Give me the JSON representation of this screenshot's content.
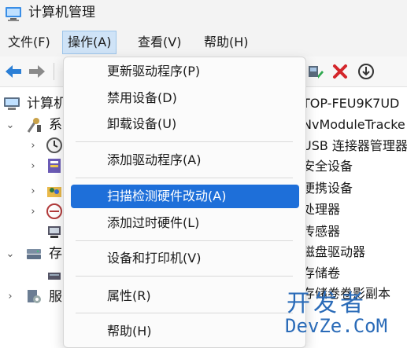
{
  "window": {
    "title": "计算机管理"
  },
  "menubar": {
    "items": [
      {
        "label": "文件(F)"
      },
      {
        "label": "操作(A)",
        "active": true
      },
      {
        "label": "查看(V)"
      },
      {
        "label": "帮助(H)"
      }
    ]
  },
  "toolbar": {
    "buttons": [
      "back-arrow-icon",
      "forward-arrow-icon",
      "update-driver-icon",
      "remove-icon",
      "download-icon"
    ]
  },
  "tree": {
    "root": "计算机",
    "system_partial": "系",
    "storage_partial": "存",
    "services_partial": "服"
  },
  "right_pane": {
    "items": [
      "TOP-FEU9K7UD",
      "NvModuleTracke",
      "USB 连接器管理器",
      "安全设备",
      "便携设备",
      "处理器",
      "传感器",
      "磁盘驱动器",
      "存储卷",
      "存储卷卷影副本"
    ]
  },
  "context_menu": {
    "items": [
      "更新驱动程序(P)",
      "禁用设备(D)",
      "卸载设备(U)",
      "添加驱动程序(A)",
      "扫描检测硬件改动(A)",
      "添加过时硬件(L)",
      "设备和打印机(V)",
      "属性(R)",
      "帮助(H)"
    ],
    "highlighted_index": 4
  },
  "watermark": {
    "line1": "开发者",
    "line2": "DevZe.CoM"
  },
  "colors": {
    "highlight": "#1e6fd9",
    "menu_active": "#cfe3f7",
    "remove": "#d4262b",
    "watermark": "#2a6bb8"
  }
}
